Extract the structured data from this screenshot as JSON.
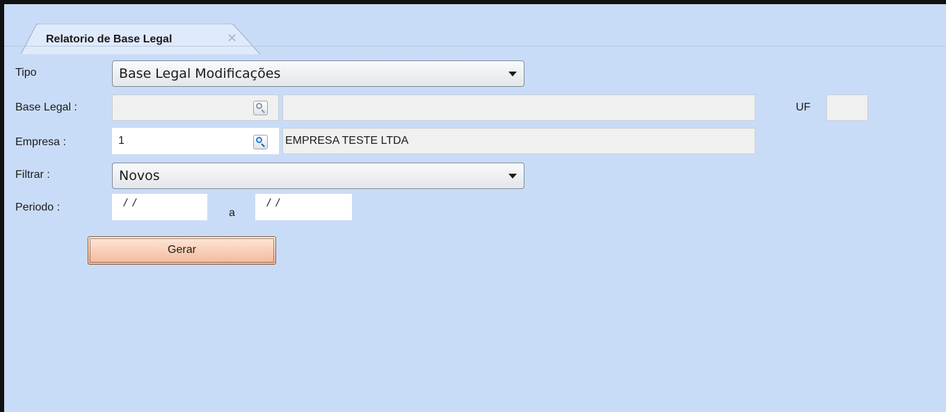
{
  "tab": {
    "title": "Relatorio de Base Legal",
    "close_glyph": "✕"
  },
  "form": {
    "tipo": {
      "label": "Tipo",
      "value": "Base Legal Modificações"
    },
    "base_legal": {
      "label": "Base Legal :",
      "code": "",
      "description": ""
    },
    "uf": {
      "label": "UF",
      "value": ""
    },
    "empresa": {
      "label": "Empresa :",
      "code": "1",
      "name": "EMPRESA TESTE LTDA"
    },
    "filtrar": {
      "label": "Filtrar :",
      "value": "Novos"
    },
    "periodo": {
      "label": "Periodo :",
      "start": "/ /",
      "separator": "a",
      "end": "/ /"
    }
  },
  "actions": {
    "gerar_label": "Gerar"
  },
  "icons": {
    "lookup": "magnifier-icon",
    "dropdown": "chevron-down-icon",
    "close": "close-icon"
  },
  "colors": {
    "background": "#c9dcf7",
    "button_gradient_top": "#ffe8d8",
    "button_gradient_bottom": "#f3b79a"
  }
}
